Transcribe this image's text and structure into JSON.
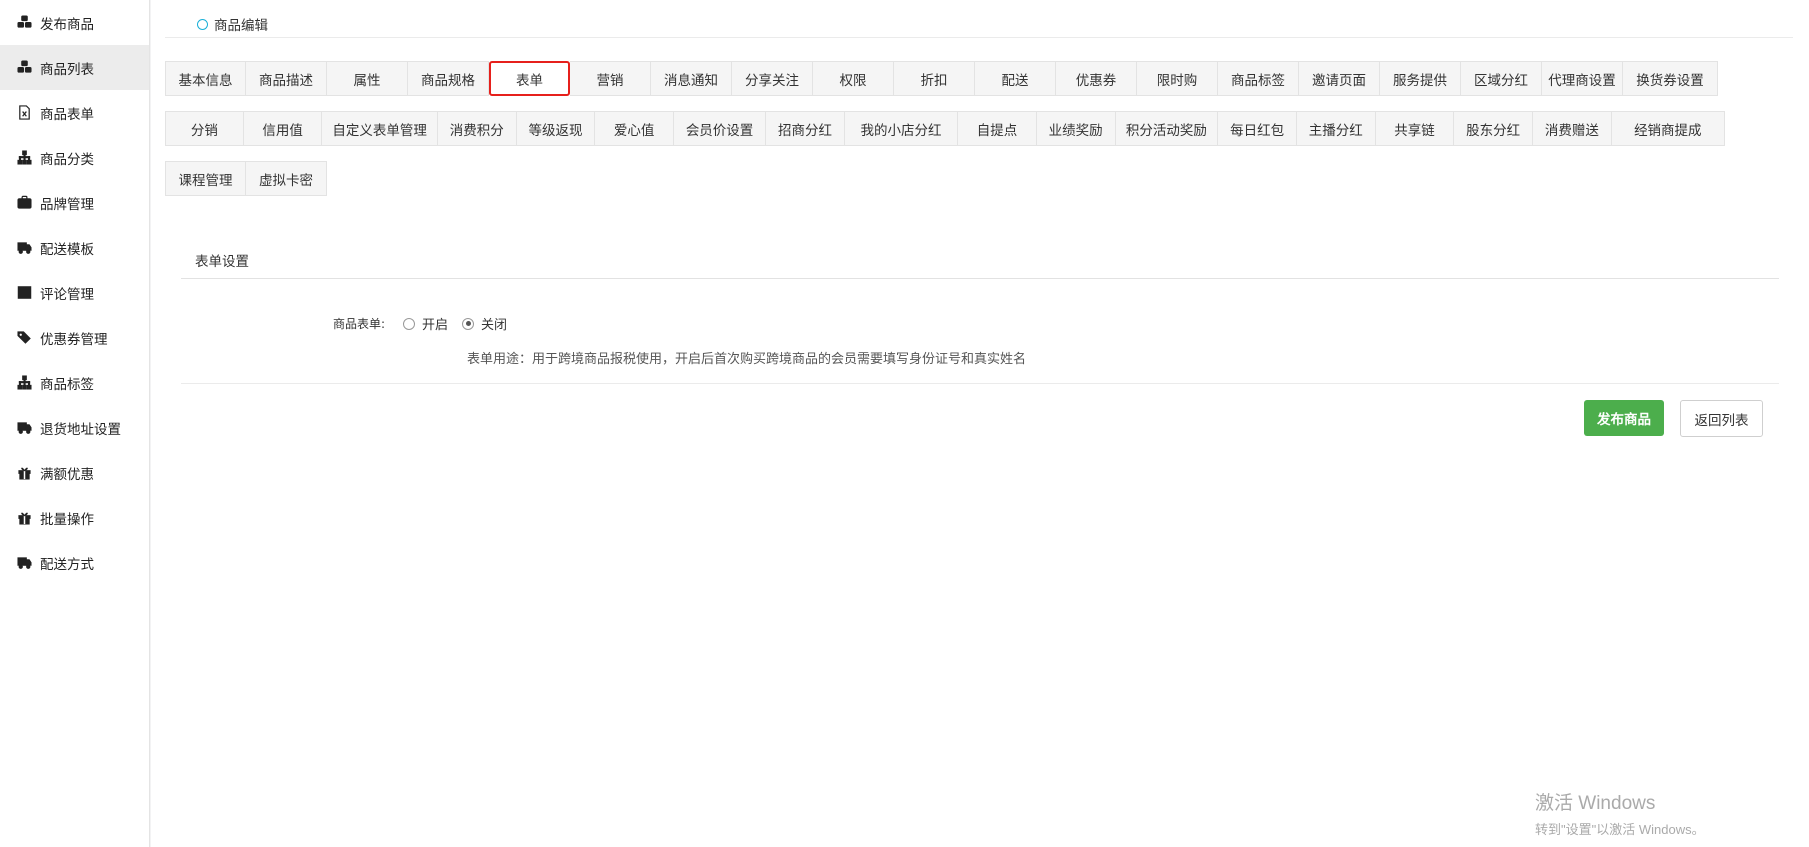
{
  "sidebar": {
    "items": [
      {
        "label": "发布商品",
        "icon": "cubes-icon"
      },
      {
        "label": "商品列表",
        "icon": "cubes-icon"
      },
      {
        "label": "商品表单",
        "icon": "excel-file-icon"
      },
      {
        "label": "商品分类",
        "icon": "sitemap-icon"
      },
      {
        "label": "品牌管理",
        "icon": "briefcase-icon"
      },
      {
        "label": "配送模板",
        "icon": "truck-icon"
      },
      {
        "label": "评论管理",
        "icon": "columns-icon"
      },
      {
        "label": "优惠券管理",
        "icon": "tags-icon"
      },
      {
        "label": "商品标签",
        "icon": "sitemap-icon"
      },
      {
        "label": "退货地址设置",
        "icon": "truck-icon"
      },
      {
        "label": "满额优惠",
        "icon": "gift-icon"
      },
      {
        "label": "批量操作",
        "icon": "gift-icon"
      },
      {
        "label": "配送方式",
        "icon": "truck-icon"
      }
    ],
    "active_index": 1
  },
  "header": {
    "title": "商品编辑"
  },
  "tabs": {
    "row1": [
      "基本信息",
      "商品描述",
      "属性",
      "商品规格",
      "表单",
      "营销",
      "消息通知",
      "分享关注",
      "权限",
      "折扣",
      "配送",
      "优惠券",
      "限时购",
      "商品标签",
      "邀请页面",
      "服务提供",
      "区域分红",
      "代理商设置",
      "换货券设置"
    ],
    "row2": [
      "分销",
      "信用值",
      "自定义表单管理",
      "消费积分",
      "等级返现",
      "爱心值",
      "会员价设置",
      "招商分红",
      "我的小店分红",
      "自提点",
      "业绩奖励",
      "积分活动奖励",
      "每日红包",
      "主播分红",
      "共享链",
      "股东分红",
      "消费赠送",
      "经销商提成"
    ],
    "row3": [
      "课程管理",
      "虚拟卡密"
    ],
    "active": "表单"
  },
  "form": {
    "section_title": "表单设置",
    "field_label": "商品表单:",
    "option_on": "开启",
    "option_off": "关闭",
    "selected": "关闭",
    "help_text": "表单用途：用于跨境商品报税使用，开启后首次购买跨境商品的会员需要填写身份证号和真实姓名"
  },
  "buttons": {
    "publish": "发布商品",
    "back": "返回列表"
  },
  "watermark": {
    "line1": "激活 Windows",
    "line2": "转到\"设置\"以激活 Windows。"
  },
  "colors": {
    "accent_green": "#4cae4c",
    "active_tab_border": "#e6201c",
    "header_circle": "#1ab0d8"
  }
}
